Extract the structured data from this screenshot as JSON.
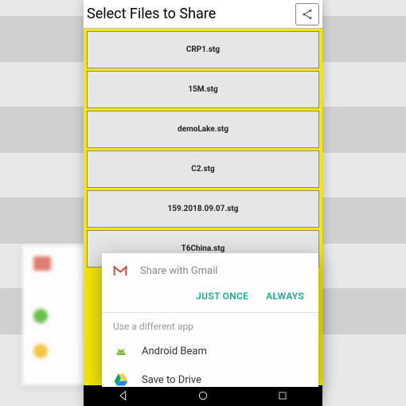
{
  "header": {
    "title": "Select Files to Share"
  },
  "files": {
    "item0": "CRP1.stg",
    "item1": "15M.stg",
    "item2": "demoLake.stg",
    "item3": "C2.stg",
    "item4": "159.2018.09.07.stg",
    "item5": "T6China.stg"
  },
  "dialog": {
    "title": "Share with Gmail",
    "just_once": "JUST ONCE",
    "always": "ALWAYS",
    "use_different": "Use a different app",
    "apps": {
      "beam": "Android Beam",
      "drive": "Save to Drive"
    }
  },
  "colors": {
    "accent": "#1aa89b",
    "bg_yellow": "#f6e60a"
  }
}
